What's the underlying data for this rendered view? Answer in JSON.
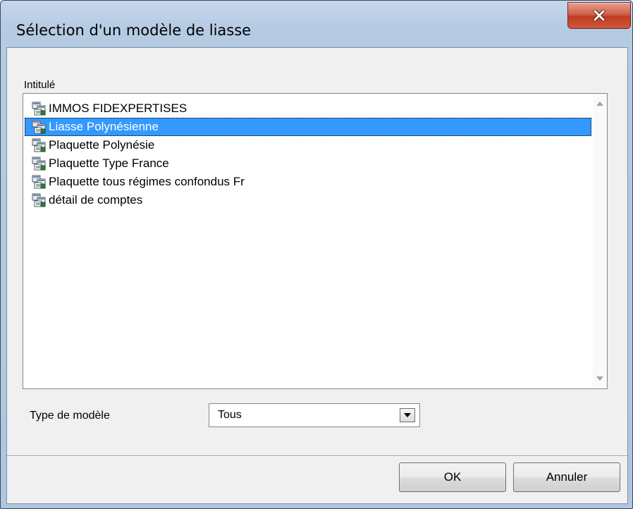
{
  "window": {
    "title": "Sélection d'un modèle de liasse",
    "close_icon": "close-icon"
  },
  "list": {
    "header": "Intitulé",
    "items": [
      {
        "label": "IMMOS FIDEXPERTISES",
        "icon": "template-icon",
        "selected": false
      },
      {
        "label": "Liasse Polynésienne",
        "icon": "template-icon",
        "selected": true
      },
      {
        "label": "Plaquette Polynésie",
        "icon": "template-icon",
        "selected": false
      },
      {
        "label": "Plaquette Type France",
        "icon": "template-icon",
        "selected": false
      },
      {
        "label": "Plaquette tous régimes confondus Fr",
        "icon": "template-icon",
        "selected": false
      },
      {
        "label": "détail de comptes",
        "icon": "template-icon",
        "selected": false
      }
    ]
  },
  "filter": {
    "label": "Type de modèle",
    "value": "Tous"
  },
  "buttons": {
    "ok": "OK",
    "cancel": "Annuler"
  },
  "colors": {
    "selection": "#3399ff",
    "close_button": "#c8452b"
  }
}
